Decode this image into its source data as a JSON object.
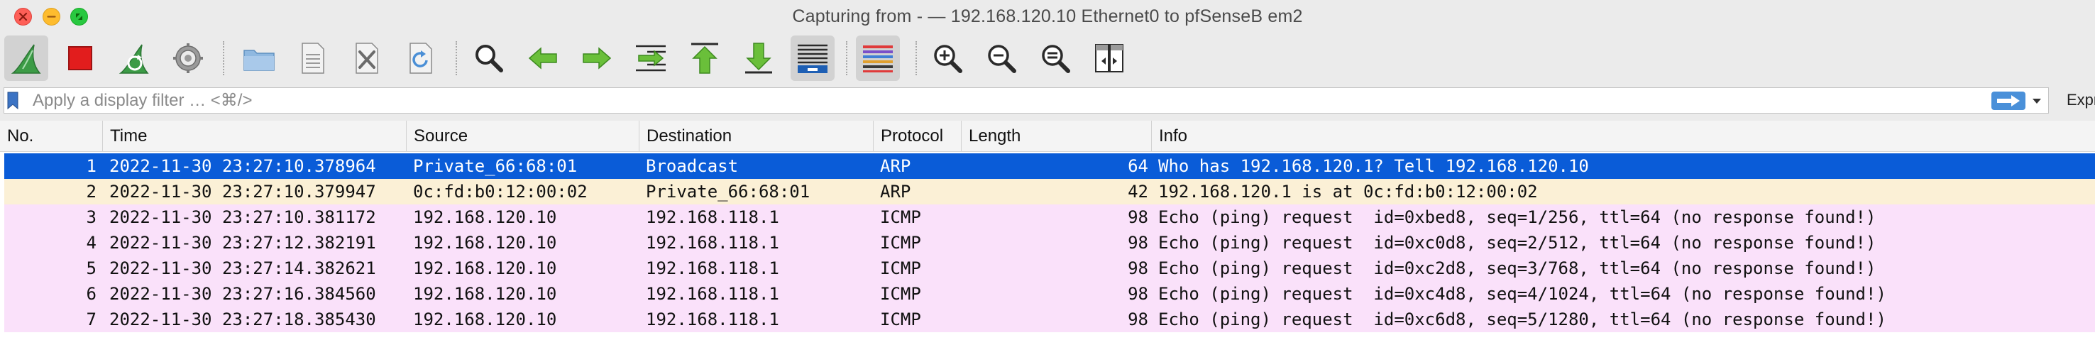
{
  "window": {
    "title": "Capturing from - — 192.168.120.10 Ethernet0 to pfSenseB em2"
  },
  "toolbar": {
    "buttons": [
      {
        "name": "start-capture",
        "icon": "shark-fin-icon"
      },
      {
        "name": "stop-capture",
        "icon": "stop-square-icon"
      },
      {
        "name": "restart-capture",
        "icon": "shark-fin-restart-icon"
      },
      {
        "name": "capture-options",
        "icon": "gear-icon"
      },
      {
        "name": "open-file",
        "icon": "folder-icon"
      },
      {
        "name": "save-file",
        "icon": "document-icon"
      },
      {
        "name": "close-file",
        "icon": "close-document-icon"
      },
      {
        "name": "reload-file",
        "icon": "reload-icon"
      },
      {
        "name": "find-packet",
        "icon": "search-icon"
      },
      {
        "name": "go-back",
        "icon": "arrow-left-icon"
      },
      {
        "name": "go-forward",
        "icon": "arrow-right-icon"
      },
      {
        "name": "go-to-packet",
        "icon": "jump-to-icon"
      },
      {
        "name": "first-packet",
        "icon": "arrow-up-bar-icon"
      },
      {
        "name": "last-packet",
        "icon": "arrow-down-bar-icon"
      },
      {
        "name": "auto-scroll",
        "icon": "autoscroll-icon"
      },
      {
        "name": "colorize",
        "icon": "colorize-lines-icon"
      },
      {
        "name": "zoom-in",
        "icon": "zoom-in-icon"
      },
      {
        "name": "zoom-out",
        "icon": "zoom-out-icon"
      },
      {
        "name": "normal-size",
        "icon": "zoom-reset-icon"
      },
      {
        "name": "resize-columns",
        "icon": "resize-columns-icon"
      }
    ]
  },
  "filter": {
    "placeholder": "Apply a display filter … <⌘/>",
    "value": "",
    "expression_label": "Expre"
  },
  "colors": {
    "selected_row": "#0a5cd8",
    "arp_row": "#fbf0d6",
    "icmp_row": "#fae1fa"
  },
  "packets": {
    "columns": [
      "No.",
      "Time",
      "Source",
      "Destination",
      "Protocol",
      "Length",
      "Info"
    ],
    "rows": [
      {
        "no": "1",
        "time": "2022-11-30 23:27:10.378964",
        "source": "Private_66:68:01",
        "destination": "Broadcast",
        "protocol": "ARP",
        "length": "64",
        "info": "Who has 192.168.120.1? Tell 192.168.120.10"
      },
      {
        "no": "2",
        "time": "2022-11-30 23:27:10.379947",
        "source": "0c:fd:b0:12:00:02",
        "destination": "Private_66:68:01",
        "protocol": "ARP",
        "length": "42",
        "info": "192.168.120.1 is at 0c:fd:b0:12:00:02"
      },
      {
        "no": "3",
        "time": "2022-11-30 23:27:10.381172",
        "source": "192.168.120.10",
        "destination": "192.168.118.1",
        "protocol": "ICMP",
        "length": "98",
        "info": "Echo (ping) request  id=0xbed8, seq=1/256, ttl=64 (no response found!)"
      },
      {
        "no": "4",
        "time": "2022-11-30 23:27:12.382191",
        "source": "192.168.120.10",
        "destination": "192.168.118.1",
        "protocol": "ICMP",
        "length": "98",
        "info": "Echo (ping) request  id=0xc0d8, seq=2/512, ttl=64 (no response found!)"
      },
      {
        "no": "5",
        "time": "2022-11-30 23:27:14.382621",
        "source": "192.168.120.10",
        "destination": "192.168.118.1",
        "protocol": "ICMP",
        "length": "98",
        "info": "Echo (ping) request  id=0xc2d8, seq=3/768, ttl=64 (no response found!)"
      },
      {
        "no": "6",
        "time": "2022-11-30 23:27:16.384560",
        "source": "192.168.120.10",
        "destination": "192.168.118.1",
        "protocol": "ICMP",
        "length": "98",
        "info": "Echo (ping) request  id=0xc4d8, seq=4/1024, ttl=64 (no response found!)"
      },
      {
        "no": "7",
        "time": "2022-11-30 23:27:18.385430",
        "source": "192.168.120.10",
        "destination": "192.168.118.1",
        "protocol": "ICMP",
        "length": "98",
        "info": "Echo (ping) request  id=0xc6d8, seq=5/1280, ttl=64 (no response found!)"
      }
    ]
  }
}
